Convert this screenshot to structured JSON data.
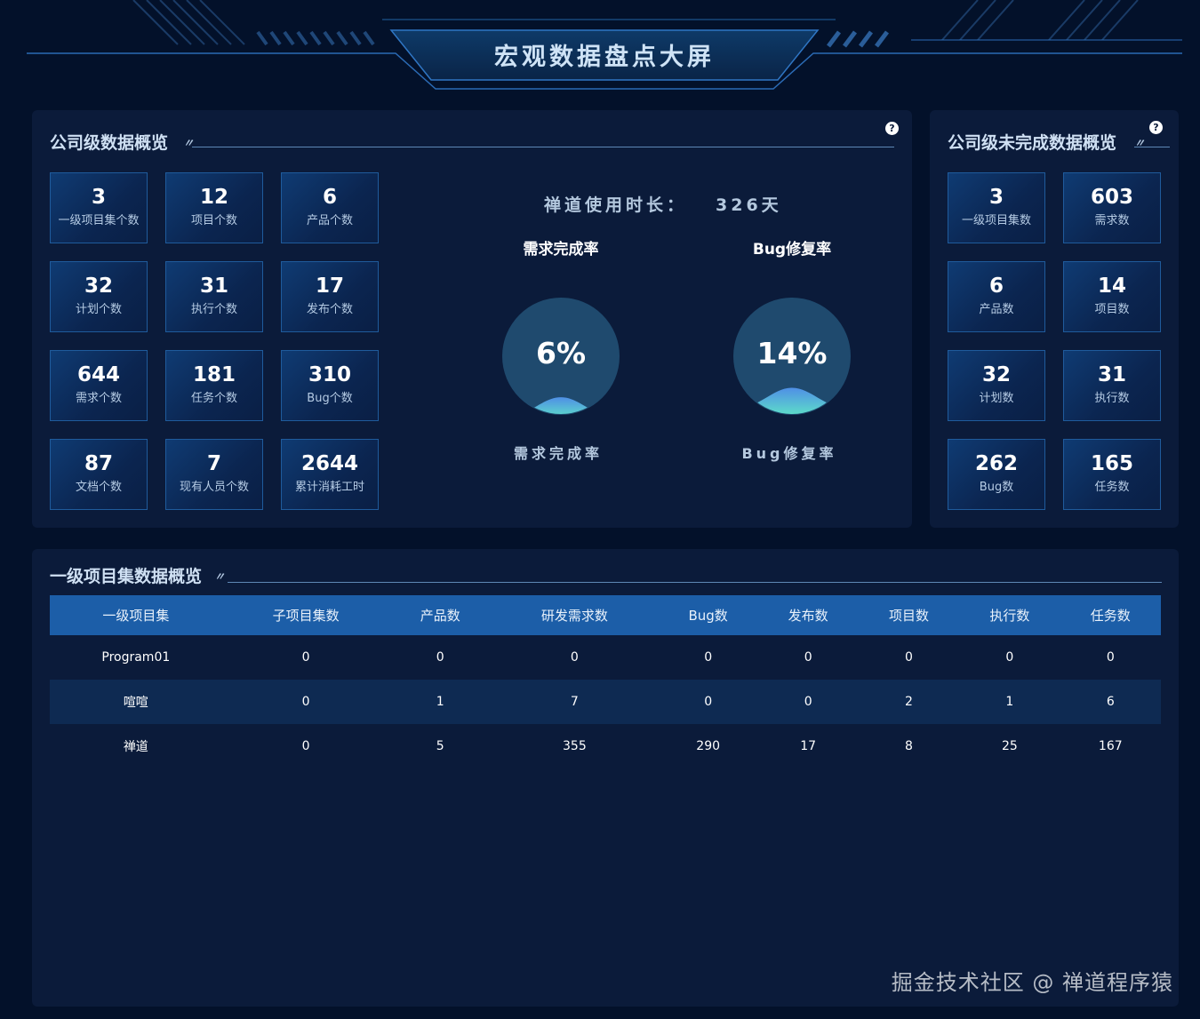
{
  "header": {
    "title": "宏观数据盘点大屏"
  },
  "company_panel": {
    "title": "公司级数据概览",
    "stats": [
      {
        "value": "3",
        "label": "一级项目集个数"
      },
      {
        "value": "12",
        "label": "项目个数"
      },
      {
        "value": "6",
        "label": "产品个数"
      },
      {
        "value": "32",
        "label": "计划个数"
      },
      {
        "value": "31",
        "label": "执行个数"
      },
      {
        "value": "17",
        "label": "发布个数"
      },
      {
        "value": "644",
        "label": "需求个数"
      },
      {
        "value": "181",
        "label": "任务个数"
      },
      {
        "value": "310",
        "label": "Bug个数"
      },
      {
        "value": "87",
        "label": "文档个数"
      },
      {
        "value": "7",
        "label": "现有人员个数"
      },
      {
        "value": "2644",
        "label": "累计消耗工时"
      }
    ],
    "usage": {
      "label": "禅道使用时长：",
      "value": "326天"
    },
    "gauges": [
      {
        "title": "需求完成率",
        "value": "6%",
        "fraction": 0.06,
        "caption": "需求完成率"
      },
      {
        "title": "Bug修复率",
        "value": "14%",
        "fraction": 0.14,
        "caption": "Bug修复率"
      }
    ]
  },
  "incomplete_panel": {
    "title": "公司级未完成数据概览",
    "stats": [
      {
        "value": "3",
        "label": "一级项目集数"
      },
      {
        "value": "603",
        "label": "需求数"
      },
      {
        "value": "6",
        "label": "产品数"
      },
      {
        "value": "14",
        "label": "项目数"
      },
      {
        "value": "32",
        "label": "计划数"
      },
      {
        "value": "31",
        "label": "执行数"
      },
      {
        "value": "262",
        "label": "Bug数"
      },
      {
        "value": "165",
        "label": "任务数"
      }
    ]
  },
  "program_panel": {
    "title": "一级项目集数据概览",
    "columns": [
      "一级项目集",
      "子项目集数",
      "产品数",
      "研发需求数",
      "Bug数",
      "发布数",
      "项目数",
      "执行数",
      "任务数"
    ],
    "rows": [
      [
        "Program01",
        "0",
        "0",
        "0",
        "0",
        "0",
        "0",
        "0",
        "0"
      ],
      [
        "喧喧",
        "0",
        "1",
        "7",
        "0",
        "0",
        "2",
        "1",
        "6"
      ],
      [
        "禅道",
        "0",
        "5",
        "355",
        "290",
        "17",
        "8",
        "25",
        "167"
      ]
    ]
  },
  "help_icon": "question-circle-icon",
  "watermark": "掘金技术社区 @ 禅道程序猿",
  "colors": {
    "background": "#03112a",
    "panel": "#0b1b3a",
    "card": "#0f3b73",
    "table_header": "#1c5ea8",
    "gauge_fill": "#1f4a6e",
    "wave_top": "#4f8fe6",
    "wave_bottom": "#5ee0c8"
  }
}
